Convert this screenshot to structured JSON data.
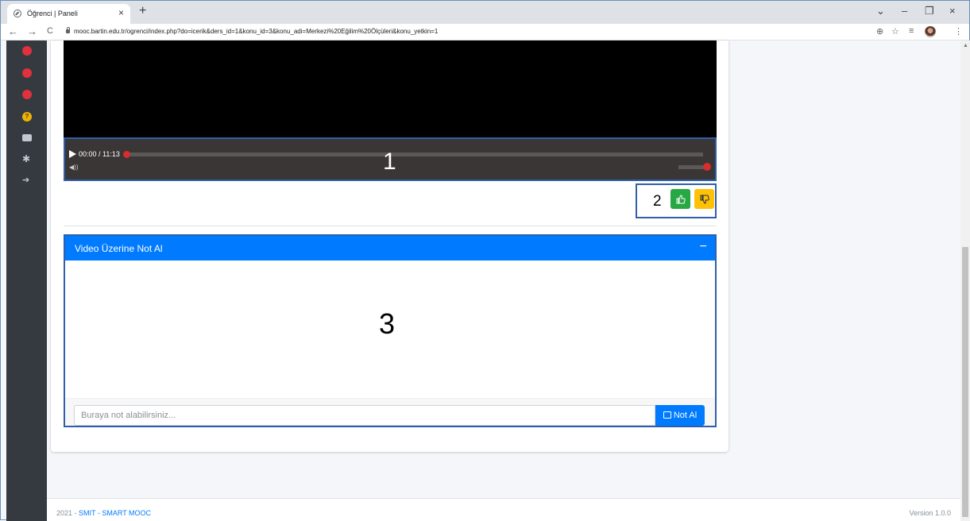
{
  "browser": {
    "tab_title": "Öğrenci | Paneli",
    "tab_close": "×",
    "new_tab": "+",
    "url": "mooc.bartin.edu.tr/ogrenci/index.php?do=icerik&ders_id=1&konu_id=3&konu_adi=Merkezi%20Eğilim%20Ölçüleri&konu_yetkin=1",
    "nav": {
      "back": "←",
      "forward": "→",
      "reload": "C"
    },
    "window_controls": {
      "dropdown": "⌄",
      "minimize": "–",
      "maximize": "❐",
      "close": "×"
    },
    "toolbar_icons": {
      "zoom": "⊕",
      "star": "☆",
      "menu": "⋮",
      "reading_list": "≡"
    }
  },
  "sidebar": {
    "icons": [
      {
        "name": "error-icon-1",
        "color": "#e0313f"
      },
      {
        "name": "error-icon-2",
        "color": "#e0313f"
      },
      {
        "name": "error-icon-3",
        "color": "#e0313f"
      },
      {
        "name": "question-icon",
        "color": "#f0b400",
        "glyph": "?"
      },
      {
        "name": "id-card-icon"
      },
      {
        "name": "bug-icon",
        "glyph": "✱"
      },
      {
        "name": "sign-out-icon",
        "glyph": "➔"
      }
    ]
  },
  "video_player": {
    "time": "00:00 / 11:13",
    "progress": 0,
    "volume": 1.0,
    "annotation": "1"
  },
  "rating": {
    "annotation": "2",
    "like_icon": "👍",
    "dislike_icon": "👎"
  },
  "note_card": {
    "title": "Video Üzerine Not Al",
    "collapse_icon": "−",
    "annotation": "3",
    "input_placeholder": "Buraya not alabilirsiniz...",
    "button_label": "Not Al"
  },
  "footer": {
    "year": "2021 -",
    "link": "SMIT - SMART MOOC",
    "version": "Version 1.0.0"
  },
  "colors": {
    "primary": "#007bff",
    "success": "#28a745",
    "warning": "#ffc107",
    "sidebar": "#343a40",
    "annotation_border": "#2f5faa"
  }
}
